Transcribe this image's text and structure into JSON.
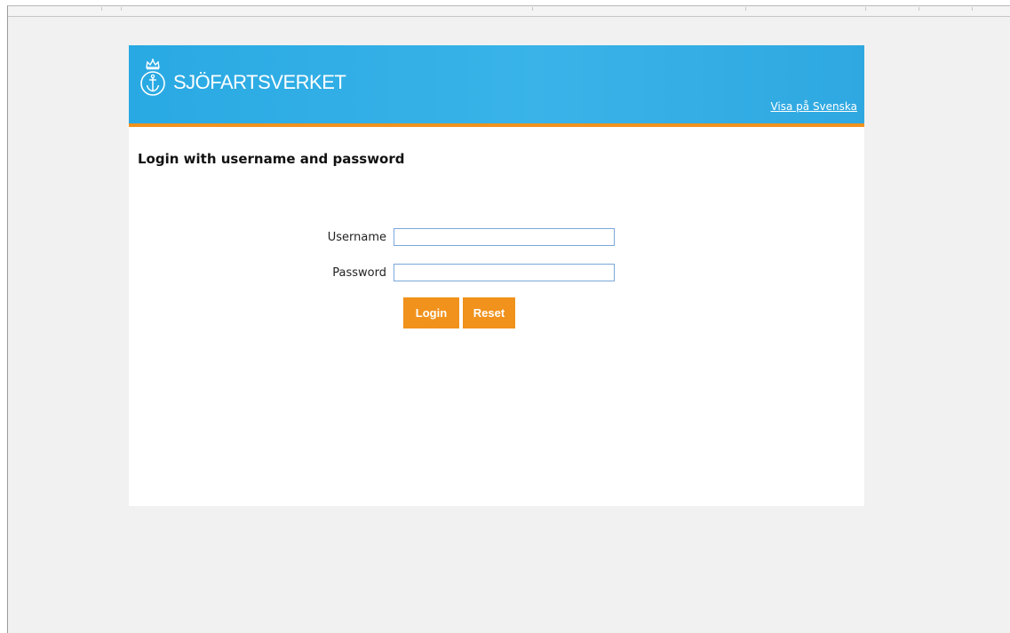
{
  "header": {
    "brand_name": "SJÖFARTSVERKET",
    "language_link": "Visa på Svenska"
  },
  "main": {
    "heading": "Login with username and password",
    "form": {
      "username_label": "Username",
      "username_value": "",
      "password_label": "Password",
      "password_value": "",
      "login_button": "Login",
      "reset_button": "Reset"
    }
  },
  "colors": {
    "banner_blue": "#29a9e3",
    "accent_orange": "#f0921c",
    "page_background": "#f1f1f1"
  },
  "icons": {
    "logo": "crown-anchor-icon"
  }
}
